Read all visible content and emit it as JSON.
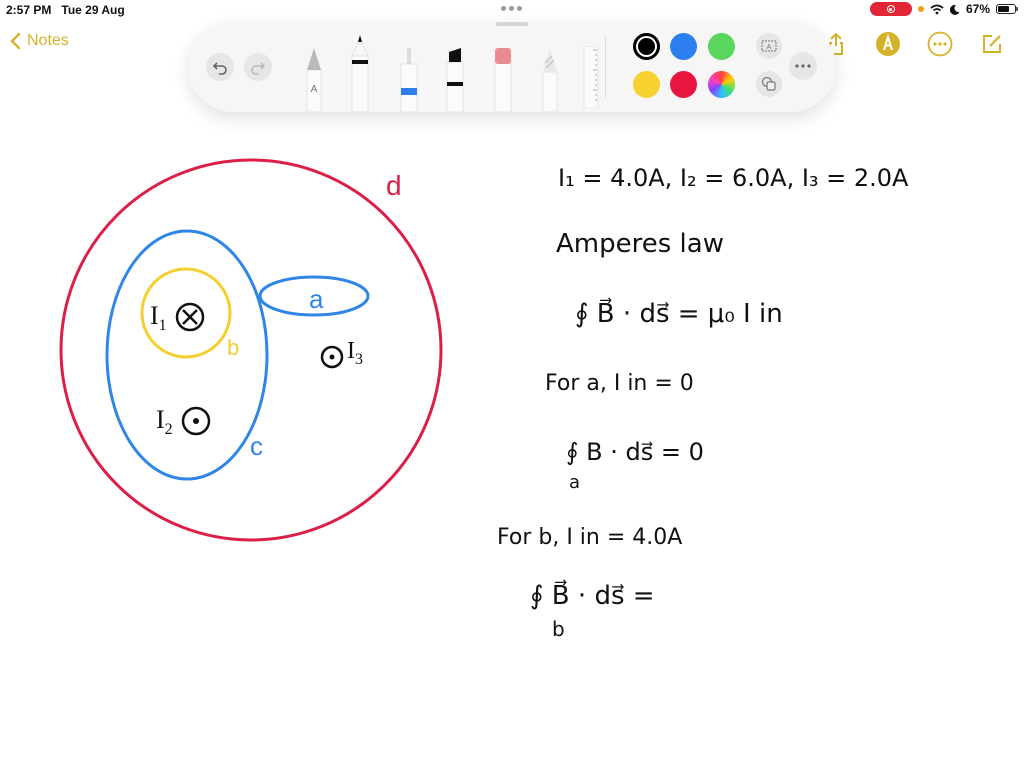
{
  "status_bar": {
    "time": "2:57 PM",
    "date": "Tue 29 Aug",
    "battery_percent": "67%",
    "battery_level": 0.67,
    "icons": [
      "screen-record-icon",
      "mic-indicator-icon",
      "wifi-icon",
      "do-not-disturb-moon-icon",
      "battery-icon"
    ]
  },
  "nav": {
    "back_label": "Notes",
    "right_icons": [
      "share-icon",
      "markup-pen-icon",
      "more-ellipsis-icon",
      "compose-icon"
    ]
  },
  "palette": {
    "undo_icon": "undo-icon",
    "redo_icon": "redo-icon",
    "tools": [
      {
        "name": "pen-a",
        "label": "A"
      },
      {
        "name": "marker"
      },
      {
        "name": "fineliner",
        "color": "#2d7ff0"
      },
      {
        "name": "highlighter"
      },
      {
        "name": "eraser"
      },
      {
        "name": "lasso-pencil"
      },
      {
        "name": "ruler"
      }
    ],
    "colors": [
      {
        "name": "black",
        "hex": "#000000",
        "selected": true
      },
      {
        "name": "blue",
        "hex": "#2d7ff0",
        "selected": false
      },
      {
        "name": "green",
        "hex": "#5ad65f",
        "selected": false
      },
      {
        "name": "yellow",
        "hex": "#f7d22e",
        "selected": false
      },
      {
        "name": "red",
        "hex": "#e8163e",
        "selected": false
      },
      {
        "name": "multicolor",
        "hex": "conic",
        "selected": false
      }
    ],
    "extra_icons": [
      "text-box-icon",
      "shapes-icon",
      "more-options-icon"
    ]
  },
  "diagram": {
    "loops": [
      {
        "label": "d",
        "color": "#dc1f48"
      },
      {
        "label": "c",
        "color": "#2f86e8"
      },
      {
        "label": "b",
        "color": "#f4cf2f"
      },
      {
        "label": "a",
        "color": "#2f86e8"
      }
    ],
    "currents": [
      {
        "label": "I1",
        "symbol": "into-page"
      },
      {
        "label": "I2",
        "symbol": "out-of-page"
      },
      {
        "label": "I3",
        "symbol": "out-of-page"
      }
    ]
  },
  "notes": {
    "given": "I₁ = 4.0A,  I₂ = 6.0A,  I₃ = 2.0A",
    "heading": "Amperes law",
    "law": "∮ B⃗ · ds⃗  =  μ₀ I in",
    "case_a_title": "For   a,      I in = 0",
    "case_a_eq": "∮ B · ds⃗ = 0",
    "case_a_sub": "a",
    "case_b_title": "For  b,    I in =  4.0A",
    "case_b_eq": "∮ B⃗ · ds⃗ =",
    "case_b_sub": "b"
  }
}
